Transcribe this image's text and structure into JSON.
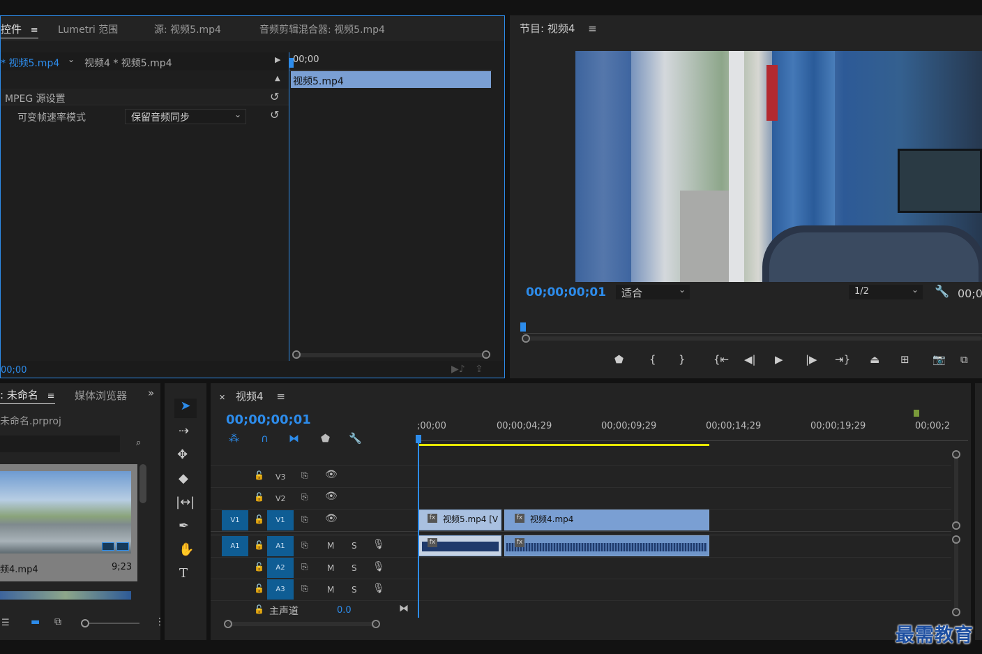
{
  "effect_controls": {
    "tabs": [
      {
        "label": "控件"
      },
      {
        "label": "Lumetri 范围"
      },
      {
        "label": "源: 视频5.mp4"
      },
      {
        "label": "音频剪辑混合器: 视频5.mp4"
      }
    ],
    "source_clip": "* 视频5.mp4",
    "sequence_clip": "视频4 * 视频5.mp4",
    "mini_timecode": "00;00",
    "mini_clip_label": "视频5.mp4",
    "section_header": "MPEG 源设置",
    "property_label": "可变帧速率模式",
    "property_value": "保留音频同步",
    "bottom_timecode": "00;00"
  },
  "program_monitor": {
    "title": "节目: 视频4",
    "timecode": "00;00;00;01",
    "fit_label": "适合",
    "resolution": "1/2",
    "duration_partial": "00;0"
  },
  "project": {
    "tabs": [
      {
        "label": ": 未命名"
      },
      {
        "label": "媒体浏览器"
      }
    ],
    "project_file": "未命名.prproj",
    "item_name": "频4.mp4",
    "item_duration": "9;23"
  },
  "timeline": {
    "sequence_name": "视频4",
    "timecode": "00;00;00;01",
    "ruler_labels": [
      ";00;00",
      "00;00;04;29",
      "00;00;09;29",
      "00;00;14;29",
      "00;00;19;29",
      "00;00;2"
    ],
    "tracks": {
      "video": [
        {
          "label": "V3"
        },
        {
          "label": "V2"
        },
        {
          "label": "V1",
          "source": "V1"
        }
      ],
      "audio": [
        {
          "label": "A1",
          "source": "A1"
        },
        {
          "label": "A2"
        },
        {
          "label": "A3"
        }
      ],
      "master_label": "主声道",
      "master_value": "0.0",
      "mute_label": "M",
      "solo_label": "S"
    },
    "clips": {
      "v1_clip1": "视频5.mp4 [V",
      "v1_clip2": "视频4.mp4",
      "fx_badge": "fx"
    }
  },
  "watermark": "最需教育",
  "colors": {
    "accent_blue": "#2d8ceb",
    "clip_blue": "#7a9fd3",
    "track_blue": "#0f5d94",
    "work_area_yellow": "#e6e600",
    "marker_green": "#7a9a3a"
  }
}
